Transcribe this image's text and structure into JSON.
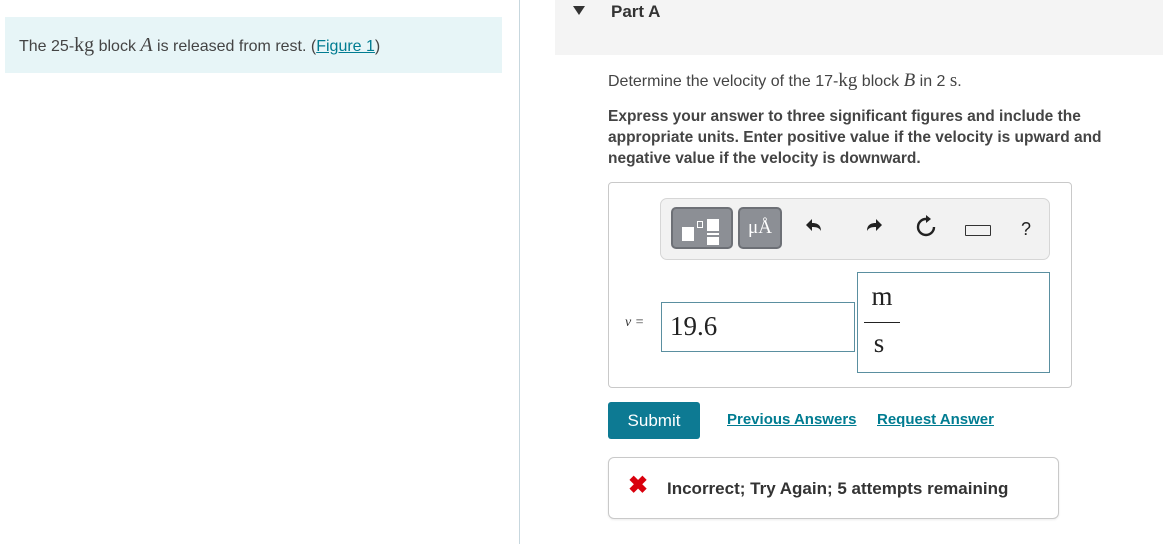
{
  "problem": {
    "text_before": "The 25-",
    "unit_kg": "kg",
    "text_middle": " block ",
    "var_a": "A",
    "text_after": " is released from rest. (",
    "figure_link": "Figure 1",
    "close_paren": ")"
  },
  "part": {
    "title": "Part A"
  },
  "question": {
    "text_before": "Determine the velocity of the 17-",
    "unit_kg": "kg",
    "text_middle": " block ",
    "var_b": "B",
    "text_in": " in 2 ",
    "unit_s": "s",
    "period": "."
  },
  "instructions": "Express your answer to three significant figures and include the appropriate units. Enter positive value if the velocity is upward and negative value if the velocity is downward.",
  "toolbar": {
    "units_label": "μÅ",
    "help_label": "?",
    "icons": [
      "templates-icon",
      "units-icon",
      "undo-icon",
      "redo-icon",
      "reset-icon",
      "keyboard-icon",
      "help-icon"
    ]
  },
  "answer": {
    "variable_label": "v =",
    "value": "19.6",
    "unit_numerator": "m",
    "unit_denominator": "s"
  },
  "actions": {
    "submit_label": "Submit",
    "previous_answers": "Previous Answers",
    "request_answer": "Request Answer"
  },
  "feedback": {
    "icon": "✖",
    "message": "Incorrect; Try Again; 5 attempts remaining",
    "color": "#d9000d"
  },
  "colors": {
    "accent": "#0d7a93",
    "link": "#007c91",
    "problem_bg": "#e7f5f7"
  }
}
